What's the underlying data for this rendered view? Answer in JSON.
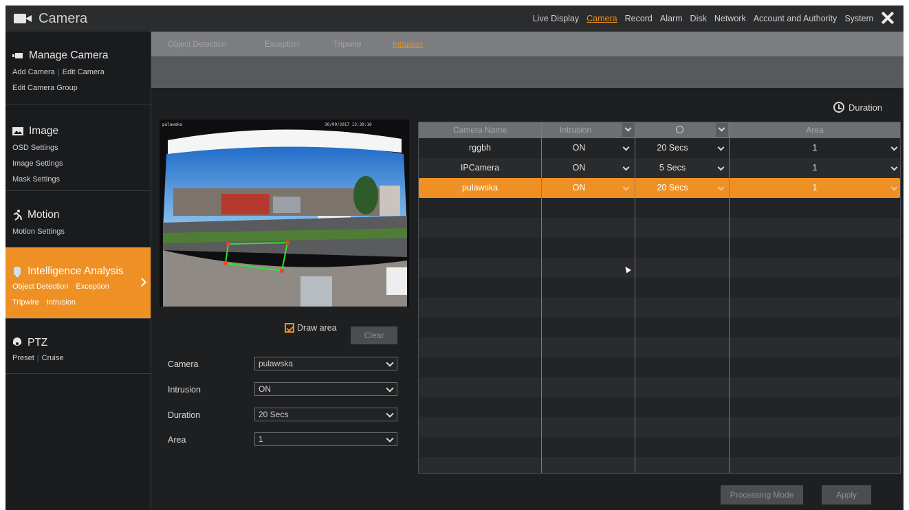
{
  "app": {
    "title": "Camera"
  },
  "topnav": {
    "items": [
      "Live Display",
      "Camera",
      "Record",
      "Alarm",
      "Disk",
      "Network",
      "Account and Authority",
      "System"
    ],
    "active": "Camera"
  },
  "sidebar": {
    "manage": {
      "title": "Manage Camera",
      "links": [
        "Add Camera",
        "Edit Camera",
        "Edit Camera Group"
      ]
    },
    "image": {
      "title": "Image",
      "links": [
        "OSD Settings",
        "Image Settings",
        "Mask Settings"
      ]
    },
    "motion": {
      "title": "Motion",
      "links": [
        "Motion Settings"
      ]
    },
    "intel": {
      "title": "Intelligence Analysis",
      "links": [
        "Object Detection",
        "Exception",
        "Tripwire",
        "Intrusion"
      ]
    },
    "ptz": {
      "title": "PTZ",
      "links": [
        "Preset",
        "Cruise"
      ]
    }
  },
  "tabs": [
    "Object Detection",
    "Exception",
    "Tripwire",
    "Intrusion"
  ],
  "active_tab": "Intrusion",
  "main": {
    "duration_link": "Duration",
    "preview": {
      "osd_name": "pulawska",
      "osd_time": "30/09/2017 13:30:10"
    },
    "draw_area_label": "Draw area",
    "clear_button": "Clear",
    "form": {
      "camera": {
        "label": "Camera",
        "value": "pulawska"
      },
      "intrusion": {
        "label": "Intrusion",
        "value": "ON"
      },
      "duration": {
        "label": "Duration",
        "value": "20 Secs"
      },
      "area": {
        "label": "Area",
        "value": "1"
      }
    },
    "processing_mode_button": "Processing Mode",
    "apply_button": "Apply"
  },
  "table": {
    "headers": {
      "camera_name": "Camera Name",
      "intrusion": "Intrusion",
      "area": "Area"
    },
    "rows": [
      {
        "camera": "rggbh",
        "intrusion": "ON",
        "duration": "20 Secs",
        "area": "1",
        "selected": false
      },
      {
        "camera": "IPCamera",
        "intrusion": "ON",
        "duration": "5 Secs",
        "area": "1",
        "selected": false
      },
      {
        "camera": "pulawska",
        "intrusion": "ON",
        "duration": "20 Secs",
        "area": "1",
        "selected": true
      }
    ]
  },
  "colors": {
    "accent": "#ef9025",
    "background": "#1e1f21",
    "tabbar": "#7c7d7f"
  },
  "icons": [
    "camera-icon",
    "close-icon",
    "manage-camera-icon",
    "image-icon",
    "motion-icon",
    "intelligence-icon",
    "ptz-icon",
    "clock-icon",
    "chevron-down-icon",
    "chevron-right-icon",
    "checkbox-icon"
  ]
}
